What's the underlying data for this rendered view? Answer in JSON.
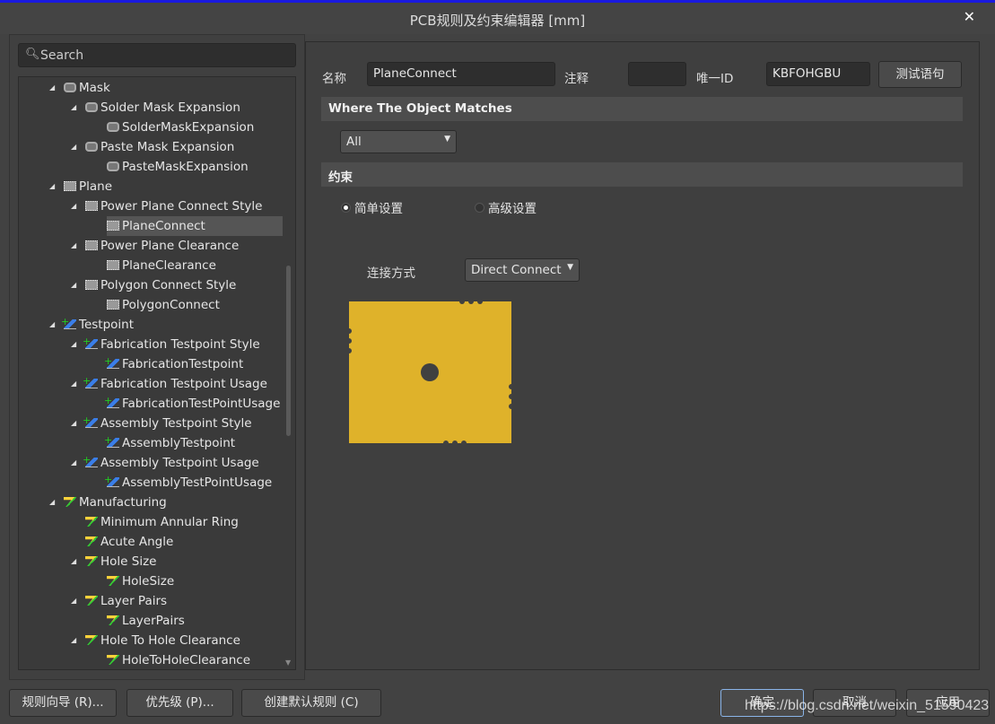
{
  "window": {
    "title": "PCB规则及约束编辑器 [mm]",
    "close_icon": "close-icon"
  },
  "search": {
    "placeholder": "Search"
  },
  "tree": [
    {
      "level": 0,
      "expanded": true,
      "icon": "mask",
      "label": "Mask"
    },
    {
      "level": 1,
      "expanded": true,
      "icon": "mask",
      "label": "Solder Mask Expansion"
    },
    {
      "level": 2,
      "icon": "mask",
      "label": "SolderMaskExpansion"
    },
    {
      "level": 1,
      "expanded": true,
      "icon": "mask",
      "label": "Paste Mask Expansion"
    },
    {
      "level": 2,
      "icon": "mask",
      "label": "PasteMaskExpansion"
    },
    {
      "level": 0,
      "expanded": true,
      "icon": "plane",
      "label": "Plane"
    },
    {
      "level": 1,
      "expanded": true,
      "icon": "plane",
      "label": "Power Plane Connect Style"
    },
    {
      "level": 2,
      "icon": "plane",
      "label": "PlaneConnect",
      "selected": true
    },
    {
      "level": 1,
      "expanded": true,
      "icon": "plane",
      "label": "Power Plane Clearance"
    },
    {
      "level": 2,
      "icon": "plane",
      "label": "PlaneClearance"
    },
    {
      "level": 1,
      "expanded": true,
      "icon": "plane",
      "label": "Polygon Connect Style"
    },
    {
      "level": 2,
      "icon": "plane",
      "label": "PolygonConnect"
    },
    {
      "level": 0,
      "expanded": true,
      "icon": "tp",
      "label": "Testpoint"
    },
    {
      "level": 1,
      "expanded": true,
      "icon": "tp",
      "label": "Fabrication Testpoint Style"
    },
    {
      "level": 2,
      "icon": "tp",
      "label": "FabricationTestpoint"
    },
    {
      "level": 1,
      "expanded": true,
      "icon": "tp",
      "label": "Fabrication Testpoint Usage"
    },
    {
      "level": 2,
      "icon": "tp",
      "label": "FabricationTestPointUsage"
    },
    {
      "level": 1,
      "expanded": true,
      "icon": "tp",
      "label": "Assembly Testpoint Style"
    },
    {
      "level": 2,
      "icon": "tp",
      "label": "AssemblyTestpoint"
    },
    {
      "level": 1,
      "expanded": true,
      "icon": "tp",
      "label": "Assembly Testpoint Usage"
    },
    {
      "level": 2,
      "icon": "tp",
      "label": "AssemblyTestPointUsage"
    },
    {
      "level": 0,
      "expanded": true,
      "icon": "mf",
      "label": "Manufacturing"
    },
    {
      "level": 1,
      "icon": "mf",
      "label": "Minimum Annular Ring"
    },
    {
      "level": 1,
      "icon": "mf",
      "label": "Acute Angle"
    },
    {
      "level": 1,
      "expanded": true,
      "icon": "mf",
      "label": "Hole Size"
    },
    {
      "level": 2,
      "icon": "mf",
      "label": "HoleSize"
    },
    {
      "level": 1,
      "expanded": true,
      "icon": "mf",
      "label": "Layer Pairs"
    },
    {
      "level": 2,
      "icon": "mf",
      "label": "LayerPairs"
    },
    {
      "level": 1,
      "expanded": true,
      "icon": "mf",
      "label": "Hole To Hole Clearance"
    },
    {
      "level": 2,
      "icon": "mf",
      "label": "HoleToHoleClearance"
    }
  ],
  "rule": {
    "name_label": "名称",
    "name_value": "PlaneConnect",
    "comment_label": "注释",
    "comment_value": "",
    "id_label": "唯一ID",
    "id_value": "KBFOHGBU",
    "test_button": "测试语句"
  },
  "where": {
    "header": "Where The Object Matches",
    "scope": "All"
  },
  "constraints": {
    "header": "约束",
    "simple": "简单设置",
    "advanced": "高级设置",
    "mode": "simple",
    "connect_label": "连接方式",
    "connect_value": "Direct Connect",
    "copper_color": "#dfb22a"
  },
  "bottom": {
    "wizard": "规则向导 (R)...",
    "priority": "优先级 (P)...",
    "create_default": "创建默认规则 (C)",
    "ok": "确定",
    "cancel": "取消",
    "apply": "应用"
  },
  "watermark": "https://blog.csdn.net/weixin_51590423"
}
